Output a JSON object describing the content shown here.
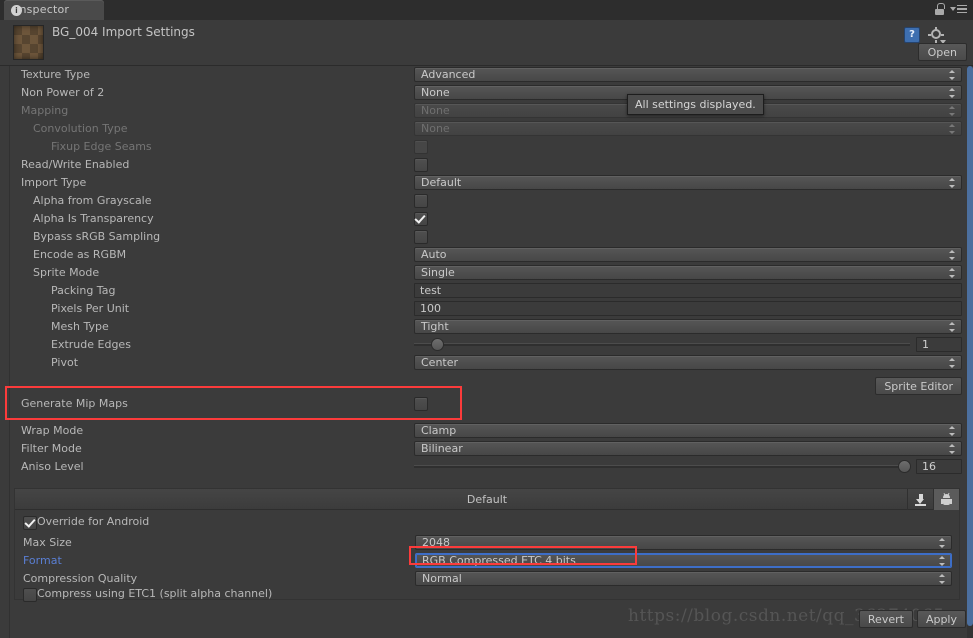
{
  "window": {
    "tab_label": "Inspector",
    "tab_icon": "info-icon",
    "lock_icon": "lock-icon",
    "menu_icon": "hamburger-menu-icon"
  },
  "header": {
    "asset_title": "BG_004 Import Settings",
    "thumbnail": "texture-thumbnail",
    "help_icon": "help-book-icon",
    "help_glyph": "?",
    "gear_icon": "gear-icon",
    "open_label": "Open"
  },
  "tooltip": {
    "text": "All settings displayed."
  },
  "rows": [
    {
      "label": "Texture Type",
      "value": "Advanced",
      "kind": "popup",
      "indent": 0,
      "dim": false
    },
    {
      "label": "Non Power of 2",
      "value": "None",
      "kind": "popup",
      "indent": 0,
      "dim": false
    },
    {
      "label": "Mapping",
      "value": "None",
      "kind": "popup",
      "indent": 0,
      "dim": true
    },
    {
      "label": "Convolution Type",
      "value": "None",
      "kind": "popup",
      "indent": 1,
      "dim": true
    },
    {
      "label": "Fixup Edge Seams",
      "value": "",
      "kind": "checkbox",
      "indent": 2,
      "dim": true,
      "checked": false
    },
    {
      "label": "Read/Write Enabled",
      "value": "",
      "kind": "checkbox",
      "indent": 0,
      "dim": false,
      "checked": false
    },
    {
      "label": "Import Type",
      "value": "Default",
      "kind": "popup",
      "indent": 0,
      "dim": false
    },
    {
      "label": "Alpha from Grayscale",
      "value": "",
      "kind": "checkbox",
      "indent": 1,
      "dim": false,
      "checked": false
    },
    {
      "label": "Alpha Is Transparency",
      "value": "",
      "kind": "checkbox",
      "indent": 1,
      "dim": false,
      "checked": true
    },
    {
      "label": "Bypass sRGB Sampling",
      "value": "",
      "kind": "checkbox",
      "indent": 1,
      "dim": false,
      "checked": false
    },
    {
      "label": "Encode as RGBM",
      "value": "Auto",
      "kind": "popup",
      "indent": 1,
      "dim": false
    },
    {
      "label": "Sprite Mode",
      "value": "Single",
      "kind": "popup",
      "indent": 1,
      "dim": false
    },
    {
      "label": "Packing Tag",
      "value": "test",
      "kind": "text",
      "indent": 2,
      "dim": false
    },
    {
      "label": "Pixels Per Unit",
      "value": "100",
      "kind": "text",
      "indent": 2,
      "dim": false
    },
    {
      "label": "Mesh Type",
      "value": "Tight",
      "kind": "popup",
      "indent": 2,
      "dim": false
    },
    {
      "label": "Extrude Edges",
      "value": "1",
      "kind": "slider",
      "indent": 2,
      "dim": false,
      "fill": 0.035
    },
    {
      "label": "Pivot",
      "value": "Center",
      "kind": "popup",
      "indent": 2,
      "dim": false
    }
  ],
  "sprite_editor": {
    "label": "Sprite Editor"
  },
  "mipmaps_row": {
    "label": "Generate Mip Maps",
    "checked": false
  },
  "rows2": [
    {
      "label": "Wrap Mode",
      "value": "Clamp",
      "kind": "popup",
      "indent": 0
    },
    {
      "label": "Filter Mode",
      "value": "Bilinear",
      "kind": "popup",
      "indent": 0
    },
    {
      "label": "Aniso Level",
      "value": "16",
      "kind": "slider",
      "indent": 0,
      "fill": 0.995
    }
  ],
  "platform": {
    "default_label": "Default",
    "download_icon": "download-icon",
    "android_icon": "android-icon",
    "selected_tab": "android",
    "override_label": "Override for Android",
    "override_checked": true,
    "rows": [
      {
        "label": "Max Size",
        "value": "2048",
        "kind": "popup",
        "focus": false
      },
      {
        "label": "Format",
        "value": "RGB Compressed ETC 4 bits",
        "kind": "popup",
        "focus": true
      },
      {
        "label": "Compression Quality",
        "value": "Normal",
        "kind": "popup",
        "focus": false
      }
    ],
    "etc1_label": "Compress using ETC1 (split alpha channel)",
    "etc1_checked": false
  },
  "footer": {
    "revert_label": "Revert",
    "apply_label": "Apply",
    "watermark": "https://blog.csdn.net/qq_36274065"
  },
  "annotations": [
    {
      "name": "mipmaps-highlight",
      "color": "#fb3b3b"
    },
    {
      "name": "format-highlight",
      "color": "#fb3b3b"
    }
  ]
}
